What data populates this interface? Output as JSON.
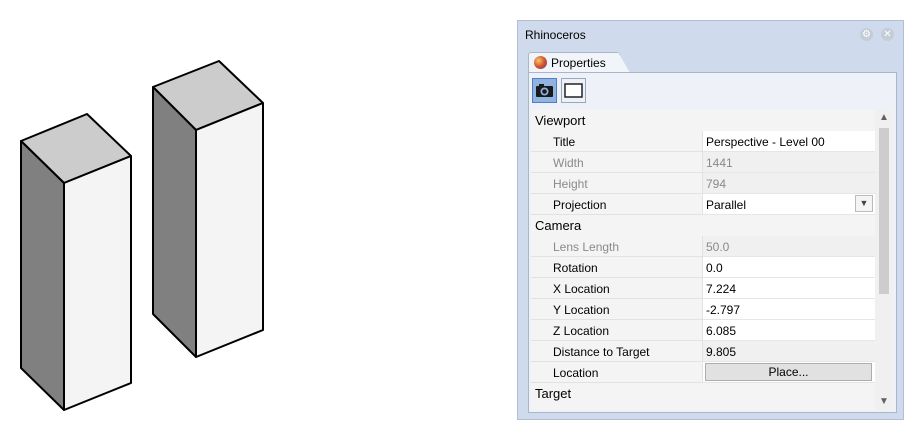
{
  "window": {
    "title": "Rhinoceros"
  },
  "titlebar_icons": {
    "gear": "gear-icon",
    "close": "close-icon"
  },
  "tab": {
    "label": "Properties",
    "icon": "rhino-properties-icon"
  },
  "mode_buttons": [
    {
      "name": "camera-mode",
      "icon": "camera-icon",
      "active": true
    },
    {
      "name": "frame-mode",
      "icon": "frame-icon",
      "active": false
    }
  ],
  "sections": {
    "viewport": "Viewport",
    "camera": "Camera",
    "target": "Target"
  },
  "props": {
    "title": {
      "label": "Title",
      "value": "Perspective - Level 00"
    },
    "width": {
      "label": "Width",
      "value": "1441"
    },
    "height": {
      "label": "Height",
      "value": "794"
    },
    "projection": {
      "label": "Projection",
      "value": "Parallel"
    },
    "lens_length": {
      "label": "Lens Length",
      "value": "50.0"
    },
    "rotation": {
      "label": "Rotation",
      "value": "0.0"
    },
    "x_location": {
      "label": "X Location",
      "value": "7.224"
    },
    "y_location": {
      "label": "Y Location",
      "value": "-2.797"
    },
    "z_location": {
      "label": "Z Location",
      "value": "6.085"
    },
    "distance_to_target": {
      "label": "Distance to Target",
      "value": "9.805"
    },
    "location": {
      "label": "Location",
      "button": "Place..."
    }
  },
  "scene": {
    "objects": [
      "box",
      "box"
    ]
  },
  "colors": {
    "panel_bg": "#cfdbec",
    "box_top": "#cccccc",
    "box_left": "#808080",
    "box_right": "#f4f4f4",
    "active_button": "#8fb4e2"
  }
}
